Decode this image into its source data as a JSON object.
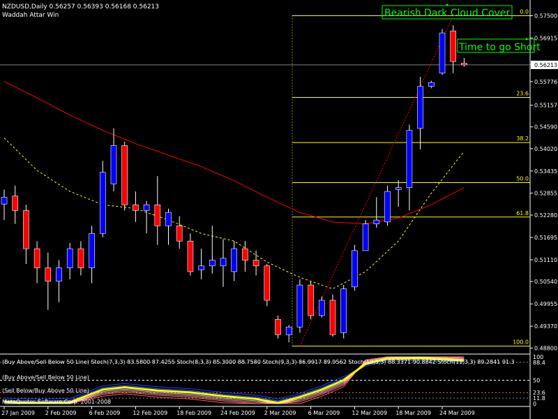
{
  "header": {
    "symbol_line": "NZDUSD,Daily  0.56257 0.56393 0.56168 0.56213",
    "indicator_name": "Waddah Attar Win"
  },
  "annotations": {
    "pattern_label": "Bearish Dark Cloud Cover",
    "signal_label": "Time to go Short"
  },
  "current_price": "0.56213",
  "oscillator": {
    "legend": "(Buy Above/Sell Below 50 Line) Stoch(7,3,3) 83.5800 87.4255  Stoch(8,3,3) 85.3000 88.7580  Stoch(9,3,3) 86.9917 89.9562  Stoch(10,3,3) 88.3371 90.8842  Stoch(11,3,3) 89.2841 91.3",
    "buy_label": "(Buy Above/Sell Below 50 Line)",
    "sell_label": "(Sell Below/Buy Above 50 Line)",
    "copyright": "MetaQuotes Software Corp. 2001-2008",
    "axis_labels": [
      "100",
      "88.4",
      "50",
      "23.6",
      "11.8",
      "0"
    ]
  },
  "colors": {
    "background": "#000000",
    "bull_candle": "#0000ff",
    "bear_candle": "#ff0000",
    "fib_line": "#ffff00",
    "ma_slow": "#ff0000",
    "ma_fast": "#ffff00",
    "label_green": "#00ff00"
  },
  "chart_data": {
    "type": "candlestick",
    "title": "NZDUSD,Daily",
    "y_ticks": [
      "0.57500",
      "0.56915",
      "0.56213",
      "0.55776",
      "0.55157",
      "0.54590",
      "0.54020",
      "0.53435",
      "0.52855",
      "0.52280",
      "0.51695",
      "0.51110",
      "0.50540",
      "0.49955",
      "0.49370",
      "0.48800"
    ],
    "ylim": [
      0.4877,
      0.5782
    ],
    "x_ticks": [
      "27 Jan 2009",
      "2 Feb 2009",
      "6 Feb 2009",
      "12 Feb 2009",
      "18 Feb 2009",
      "24 Feb 2009",
      "2 Mar 2009",
      "6 Mar 2009",
      "12 Mar 2009",
      "18 Mar 2009",
      "24 Mar 2009"
    ],
    "candles": [
      {
        "o": 0.5257,
        "h": 0.5295,
        "l": 0.5215,
        "c": 0.5275
      },
      {
        "o": 0.5278,
        "h": 0.5305,
        "l": 0.5205,
        "c": 0.524
      },
      {
        "o": 0.524,
        "h": 0.5255,
        "l": 0.51,
        "c": 0.514
      },
      {
        "o": 0.514,
        "h": 0.516,
        "l": 0.505,
        "c": 0.509
      },
      {
        "o": 0.509,
        "h": 0.513,
        "l": 0.498,
        "c": 0.5055
      },
      {
        "o": 0.5055,
        "h": 0.511,
        "l": 0.5,
        "c": 0.509
      },
      {
        "o": 0.509,
        "h": 0.5155,
        "l": 0.506,
        "c": 0.514
      },
      {
        "o": 0.514,
        "h": 0.516,
        "l": 0.507,
        "c": 0.509
      },
      {
        "o": 0.509,
        "h": 0.52,
        "l": 0.505,
        "c": 0.518
      },
      {
        "o": 0.518,
        "h": 0.537,
        "l": 0.517,
        "c": 0.534
      },
      {
        "o": 0.531,
        "h": 0.5455,
        "l": 0.529,
        "c": 0.541
      },
      {
        "o": 0.541,
        "h": 0.542,
        "l": 0.524,
        "c": 0.5255
      },
      {
        "o": 0.5255,
        "h": 0.529,
        "l": 0.521,
        "c": 0.524
      },
      {
        "o": 0.524,
        "h": 0.5265,
        "l": 0.518,
        "c": 0.5255
      },
      {
        "o": 0.5255,
        "h": 0.533,
        "l": 0.515,
        "c": 0.52
      },
      {
        "o": 0.52,
        "h": 0.5245,
        "l": 0.515,
        "c": 0.5235
      },
      {
        "o": 0.52,
        "h": 0.5225,
        "l": 0.514,
        "c": 0.516
      },
      {
        "o": 0.516,
        "h": 0.518,
        "l": 0.507,
        "c": 0.508
      },
      {
        "o": 0.5085,
        "h": 0.514,
        "l": 0.506,
        "c": 0.5095
      },
      {
        "o": 0.5095,
        "h": 0.52,
        "l": 0.5075,
        "c": 0.511
      },
      {
        "o": 0.5095,
        "h": 0.5165,
        "l": 0.504,
        "c": 0.5115
      },
      {
        "o": 0.508,
        "h": 0.516,
        "l": 0.5055,
        "c": 0.514
      },
      {
        "o": 0.514,
        "h": 0.516,
        "l": 0.508,
        "c": 0.511
      },
      {
        "o": 0.511,
        "h": 0.5135,
        "l": 0.507,
        "c": 0.5095
      },
      {
        "o": 0.5095,
        "h": 0.51,
        "l": 0.499,
        "c": 0.5005
      },
      {
        "o": 0.4955,
        "h": 0.4965,
        "l": 0.4905,
        "c": 0.4915
      },
      {
        "o": 0.4915,
        "h": 0.494,
        "l": 0.4895,
        "c": 0.4935
      },
      {
        "o": 0.4935,
        "h": 0.506,
        "l": 0.492,
        "c": 0.5045
      },
      {
        "o": 0.5045,
        "h": 0.5055,
        "l": 0.4955,
        "c": 0.4965
      },
      {
        "o": 0.4965,
        "h": 0.5015,
        "l": 0.496,
        "c": 0.5005
      },
      {
        "o": 0.5005,
        "h": 0.502,
        "l": 0.491,
        "c": 0.4915
      },
      {
        "o": 0.492,
        "h": 0.5045,
        "l": 0.4905,
        "c": 0.5035
      },
      {
        "o": 0.504,
        "h": 0.515,
        "l": 0.503,
        "c": 0.5135
      },
      {
        "o": 0.5135,
        "h": 0.5215,
        "l": 0.5135,
        "c": 0.5205
      },
      {
        "o": 0.5205,
        "h": 0.5275,
        "l": 0.5195,
        "c": 0.5215
      },
      {
        "o": 0.521,
        "h": 0.5305,
        "l": 0.52,
        "c": 0.529
      },
      {
        "o": 0.5295,
        "h": 0.532,
        "l": 0.525,
        "c": 0.53
      },
      {
        "o": 0.53,
        "h": 0.5465,
        "l": 0.524,
        "c": 0.545
      },
      {
        "o": 0.5455,
        "h": 0.559,
        "l": 0.54,
        "c": 0.5565
      },
      {
        "o": 0.5565,
        "h": 0.558,
        "l": 0.556,
        "c": 0.5575
      },
      {
        "o": 0.56,
        "h": 0.5715,
        "l": 0.5595,
        "c": 0.5705
      },
      {
        "o": 0.571,
        "h": 0.5725,
        "l": 0.56,
        "c": 0.563
      },
      {
        "o": 0.56257,
        "h": 0.56393,
        "l": 0.56168,
        "c": 0.56213
      }
    ],
    "fibonacci": [
      {
        "label": "0.0",
        "value": 0.575
      },
      {
        "label": "23.6",
        "value": 0.5536
      },
      {
        "label": "38.2",
        "value": 0.5418
      },
      {
        "label": "50.0",
        "value": 0.5313
      },
      {
        "label": "61.8",
        "value": 0.5223
      },
      {
        "label": "100.0",
        "value": 0.4885
      }
    ],
    "ma_slow": [
      [
        0,
        0.5578
      ],
      [
        3,
        0.5535
      ],
      [
        6,
        0.549
      ],
      [
        9,
        0.545
      ],
      [
        12,
        0.5415
      ],
      [
        15,
        0.5385
      ],
      [
        18,
        0.5355
      ],
      [
        21,
        0.5318
      ],
      [
        24,
        0.5275
      ],
      [
        27,
        0.5235
      ],
      [
        30,
        0.521
      ],
      [
        33,
        0.5205
      ],
      [
        36,
        0.522
      ],
      [
        39,
        0.5255
      ],
      [
        42,
        0.53
      ]
    ],
    "ma_fast": [
      [
        0,
        0.543
      ],
      [
        3,
        0.5345
      ],
      [
        6,
        0.529
      ],
      [
        9,
        0.5255
      ],
      [
        12,
        0.5245
      ],
      [
        15,
        0.5215
      ],
      [
        18,
        0.518
      ],
      [
        21,
        0.516
      ],
      [
        24,
        0.5105
      ],
      [
        27,
        0.5065
      ],
      [
        30,
        0.5035
      ],
      [
        33,
        0.508
      ],
      [
        36,
        0.516
      ],
      [
        39,
        0.5285
      ],
      [
        42,
        0.5395
      ]
    ],
    "oscillator_main": [
      [
        0,
        4
      ],
      [
        2,
        2
      ],
      [
        4,
        2
      ],
      [
        6,
        3
      ],
      [
        9,
        30
      ],
      [
        11,
        35
      ],
      [
        14,
        28
      ],
      [
        17,
        24
      ],
      [
        20,
        16
      ],
      [
        23,
        10
      ],
      [
        25,
        2
      ],
      [
        27,
        14
      ],
      [
        29,
        30
      ],
      [
        31,
        50
      ],
      [
        33,
        85
      ],
      [
        35,
        96
      ],
      [
        38,
        97
      ],
      [
        40,
        95
      ],
      [
        42,
        92
      ]
    ]
  }
}
